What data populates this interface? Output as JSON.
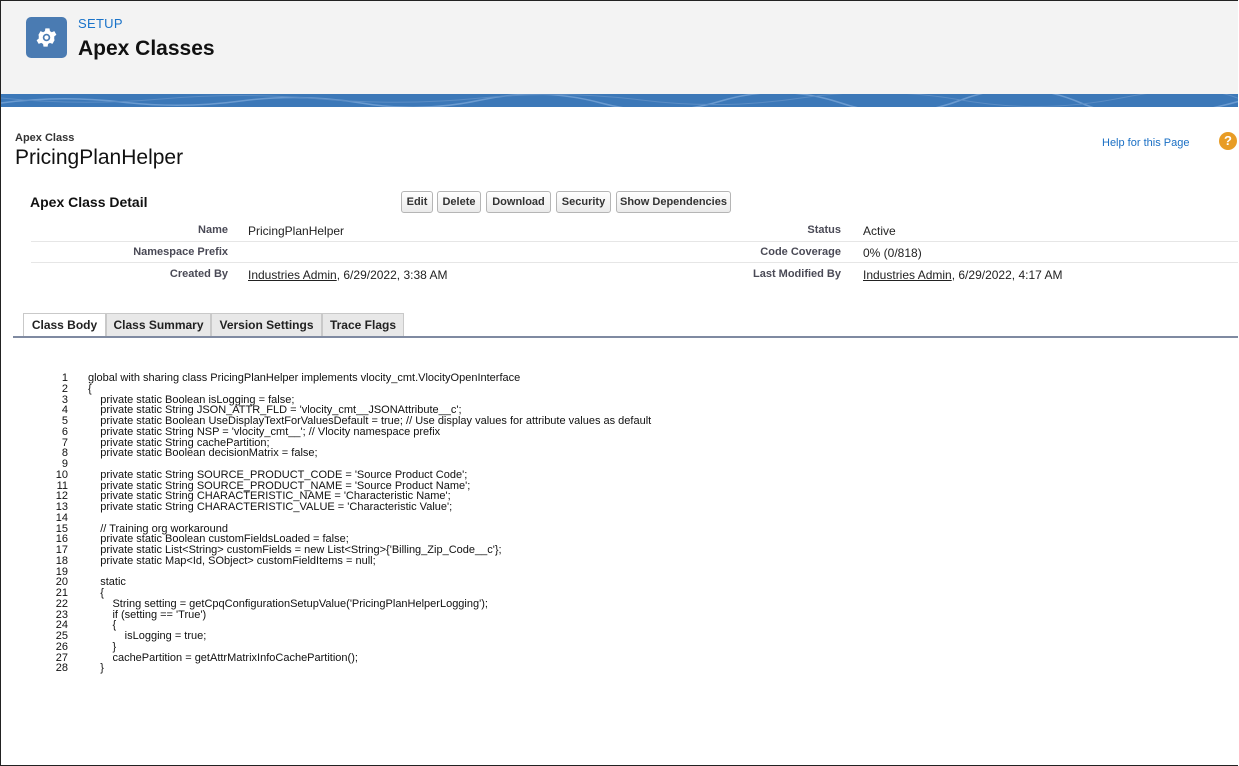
{
  "header": {
    "section": "SETUP",
    "title": "Apex Classes",
    "icon": "gear-icon",
    "color": "#4a7bb2"
  },
  "page": {
    "record_type": "Apex Class",
    "record_name": "PricingPlanHelper",
    "help_link": "Help for this Page",
    "help_icon": "question-icon"
  },
  "detail": {
    "title": "Apex Class Detail",
    "buttons": [
      "Edit",
      "Delete",
      "Download",
      "Security",
      "Show Dependencies"
    ],
    "fields": {
      "name_label": "Name",
      "name_value": "PricingPlanHelper",
      "status_label": "Status",
      "status_value": "Active",
      "namespace_label": "Namespace Prefix",
      "namespace_value": "",
      "coverage_label": "Code Coverage",
      "coverage_value": "0% (0/818)",
      "created_label": "Created By",
      "created_user": "Industries Admin",
      "created_date": ", 6/29/2022, 3:38 AM",
      "modified_label": "Last Modified By",
      "modified_user": "Industries Admin",
      "modified_date": ", 6/29/2022, 4:17 AM"
    }
  },
  "tabs": [
    "Class Body",
    "Class Summary",
    "Version Settings",
    "Trace Flags"
  ],
  "code_lines": [
    "global with sharing class PricingPlanHelper implements vlocity_cmt.VlocityOpenInterface",
    "{",
    "    private static Boolean isLogging = false;",
    "    private static String JSON_ATTR_FLD = 'vlocity_cmt__JSONAttribute__c';",
    "    private static Boolean UseDisplayTextForValuesDefault = true; // Use display values for attribute values as default",
    "    private static String NSP = 'vlocity_cmt__'; // Vlocity namespace prefix",
    "    private static String cachePartition;",
    "    private static Boolean decisionMatrix = false;",
    "",
    "    private static String SOURCE_PRODUCT_CODE = 'Source Product Code';",
    "    private static String SOURCE_PRODUCT_NAME = 'Source Product Name';",
    "    private static String CHARACTERISTIC_NAME = 'Characteristic Name';",
    "    private static String CHARACTERISTIC_VALUE = 'Characteristic Value';",
    "",
    "    // Training org workaround",
    "    private static Boolean customFieldsLoaded = false;",
    "    private static List<String> customFields = new List<String>{'Billing_Zip_Code__c'};",
    "    private static Map<Id, SObject> customFieldItems = null;",
    "",
    "    static",
    "    {",
    "        String setting = getCpqConfigurationSetupValue('PricingPlanHelperLogging');",
    "        if (setting == 'True')",
    "        {",
    "            isLogging = true;",
    "        }",
    "        cachePartition = getAttrMatrixInfoCachePartition();",
    "    }"
  ]
}
